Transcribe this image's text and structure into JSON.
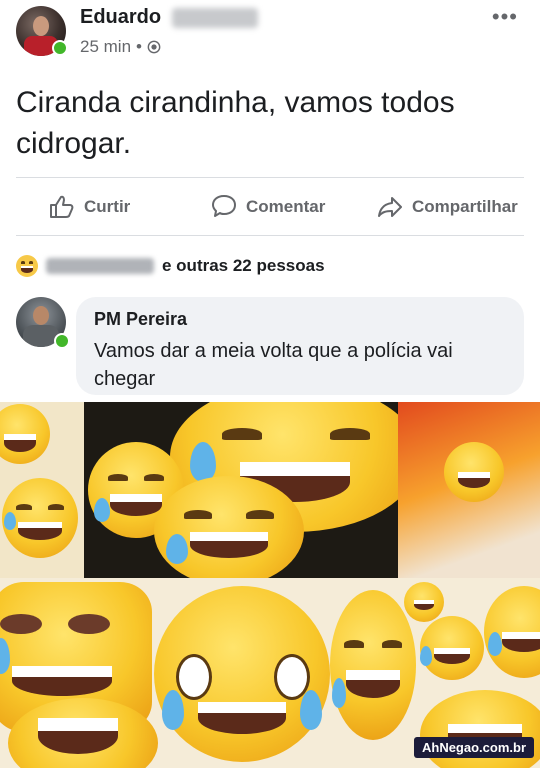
{
  "post": {
    "author": "Eduardo",
    "time": "25 min",
    "separator": "•",
    "privacy_icon": "globe-icon",
    "more_icon": "more-dots-icon",
    "text": "Ciranda cirandinha, vamos todos cidrogar."
  },
  "actions": {
    "like": "Curtir",
    "comment": "Comentar",
    "share": "Compartilhar"
  },
  "reactions": {
    "icon": "haha-reaction-icon",
    "summary": "e outras 22 pessoas"
  },
  "comment": {
    "author": "PM Pereira",
    "text": "Vamos dar a meia volta que a polícia vai chegar"
  },
  "colors": {
    "online": "#42b72a",
    "secondary_text": "#65676b",
    "bubble": "#f0f2f5",
    "emoji_yellow": "#f8c72a"
  },
  "watermark": "AhNegao.com.br"
}
